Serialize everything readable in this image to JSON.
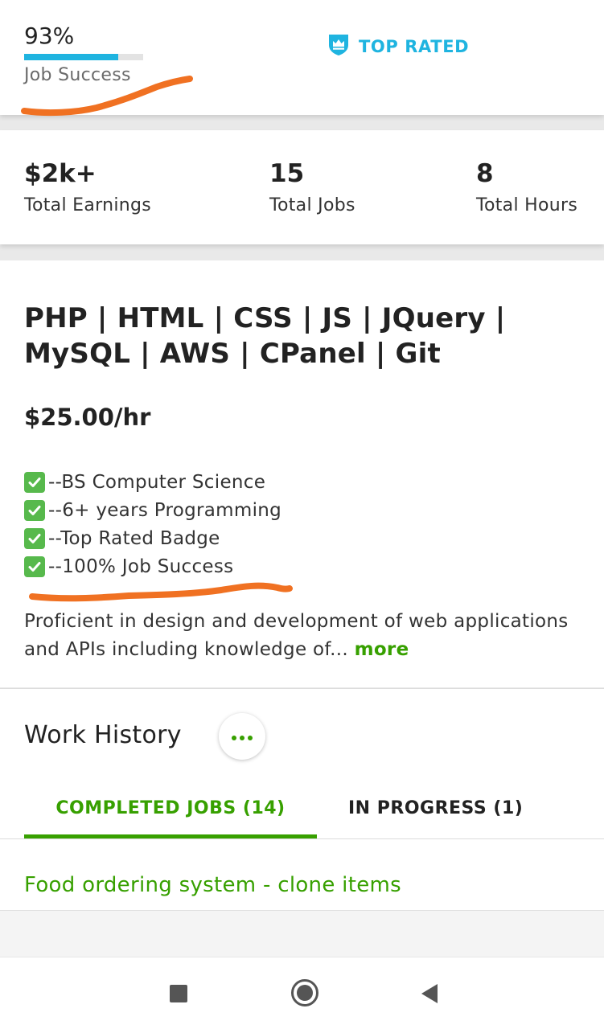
{
  "job_success": {
    "percent_text": "93%",
    "percent_value": 0.93,
    "label": "Job Success",
    "bar_color": "#1fb4e0"
  },
  "badge": {
    "icon": "crown-shield-icon",
    "label": "TOP RATED",
    "color": "#1fb4e0"
  },
  "stats": [
    {
      "value": "$2k+",
      "label": "Total Earnings"
    },
    {
      "value": "15",
      "label": "Total Jobs"
    },
    {
      "value": "8",
      "label": "Total Hours"
    }
  ],
  "profile": {
    "headline_line1": "PHP | HTML | CSS | JS | JQuery |",
    "headline_line2": "MySQL | AWS | CPanel | Git",
    "rate": "$25.00/hr",
    "bullets": [
      "--BS Computer Science",
      "--6+ years Programming",
      "--Top Rated Badge",
      "--100% Job Success"
    ],
    "bullet_icon": "check-mark-icon",
    "description": "Proficient in design and development of web applications and APIs including knowledge of...",
    "more_label": "more"
  },
  "work_history": {
    "title": "Work History",
    "menu_icon": "more-horizontal-icon",
    "tabs": [
      {
        "label": "COMPLETED JOBS (14)",
        "active": true
      },
      {
        "label": "IN PROGRESS (1)",
        "active": false
      }
    ],
    "first_job_title": "Food ordering system - clone items"
  },
  "nav": {
    "recents_icon": "square-icon",
    "home_icon": "circle-icon",
    "back_icon": "triangle-back-icon"
  },
  "colors": {
    "accent_green": "#37a000",
    "accent_blue": "#1fb4e0",
    "annotation_orange": "#f07122"
  }
}
